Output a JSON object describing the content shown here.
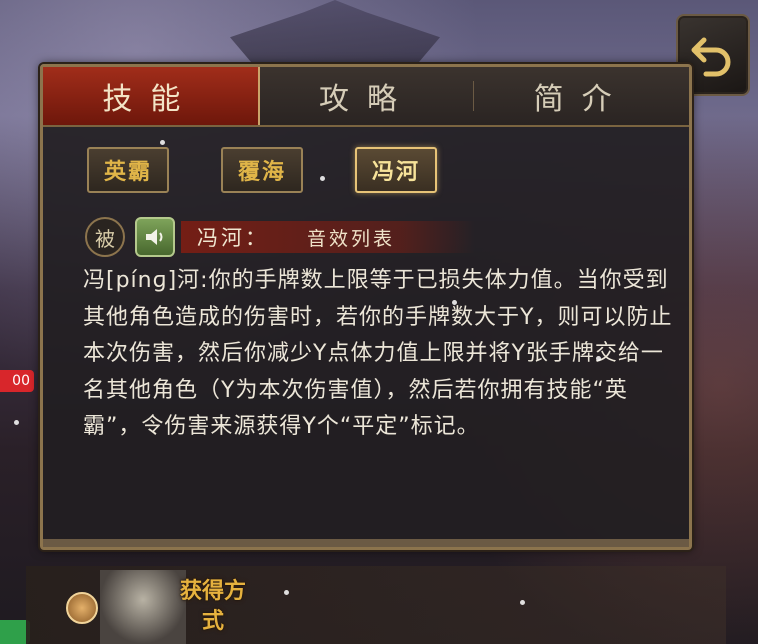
{
  "tabs": [
    {
      "label": "技能",
      "active": true
    },
    {
      "label": "攻略",
      "active": false
    },
    {
      "label": "简介",
      "active": false
    }
  ],
  "skills": [
    {
      "label": "英霸",
      "active": false
    },
    {
      "label": "覆海",
      "active": false
    },
    {
      "label": "冯河",
      "active": true
    }
  ],
  "skill_info": {
    "passive_label": "被",
    "name": "冯河：",
    "sound_list": "音效列表",
    "description": "冯[pínɡ]河:你的手牌数上限等于已损失体力值。当你受到其他角色造成的伤害时，若你的手牌数大于Y，则可以防止本次伤害，然后你减少Y点体力值上限并将Y张手牌交给一名其他角色（Y为本次伤害值），然后若你拥有技能“英霸”，令伤害来源获得Y个“平定”标记。"
  },
  "side": {
    "badge_text": "00"
  },
  "bottom": {
    "obtain_label": "获得方式"
  },
  "colors": {
    "active_tab": "#8f2414",
    "skill_text": "#e0b548",
    "border": "#8c744d"
  },
  "icons": {
    "back": "back-arrow-icon",
    "sound": "speaker-icon",
    "up": "up-arrow-icon"
  }
}
